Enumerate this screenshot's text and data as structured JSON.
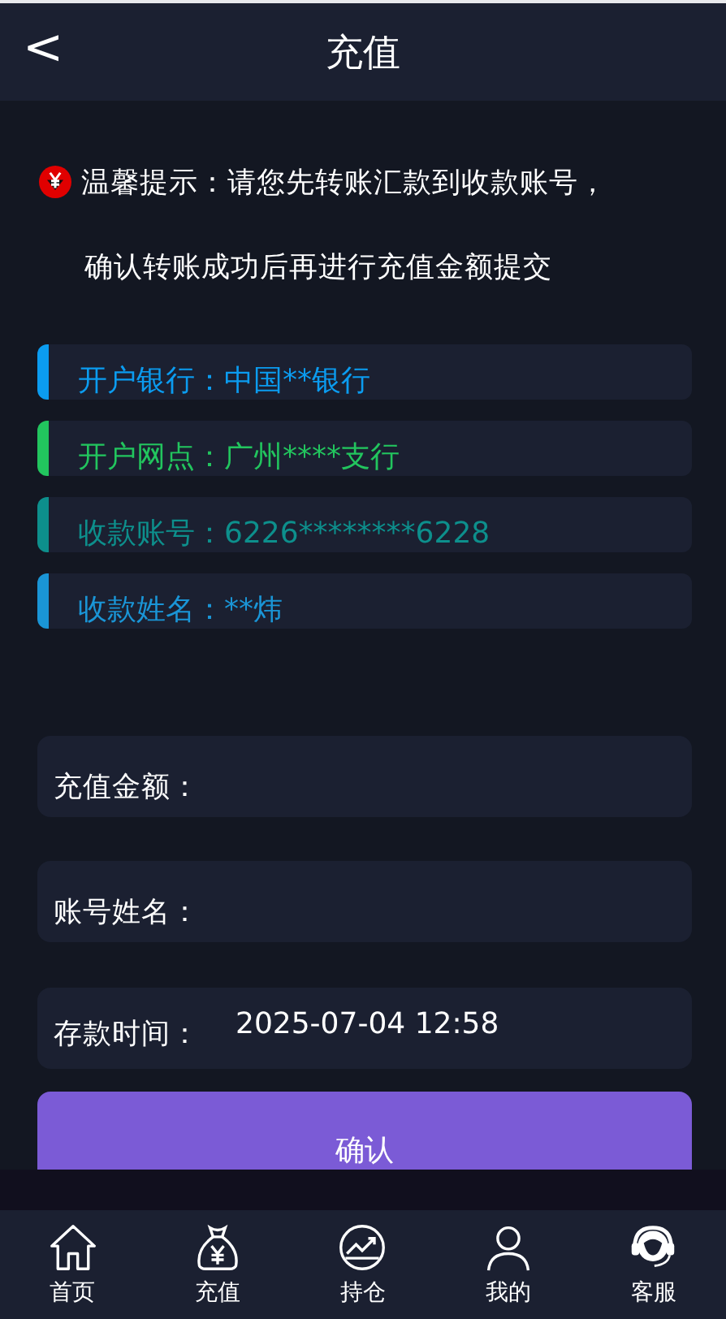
{
  "header": {
    "back": "<",
    "title": "充值"
  },
  "notice": {
    "lines": [
      "温馨提示：请您先转账汇款到收款账号，",
      "确认转账成功后再进行充值金额提交"
    ]
  },
  "account_info": [
    {
      "label": "开户银行：",
      "value": "中国**银行",
      "color": "#0b9cf0"
    },
    {
      "label": "开户网点：",
      "value": "广州****支行",
      "color": "#22c55e"
    },
    {
      "label": "收款账号：",
      "value": "6226********6228",
      "color": "#0d8f8c"
    },
    {
      "label": "收款姓名：",
      "value": "**炜",
      "color": "#1a95d6"
    }
  ],
  "form": [
    {
      "label": "充值金额："
    },
    {
      "label": "账号姓名："
    },
    {
      "label": "存款时间：",
      "value": "2025-07-04 12:58"
    }
  ],
  "submit": "确认",
  "tabs": [
    {
      "label": "首页",
      "kind": "home"
    },
    {
      "label": "充值",
      "kind": "moneybag"
    },
    {
      "label": "持仓",
      "kind": "chart"
    },
    {
      "label": "我的",
      "kind": "user"
    },
    {
      "label": "客服",
      "kind": "headset"
    }
  ]
}
